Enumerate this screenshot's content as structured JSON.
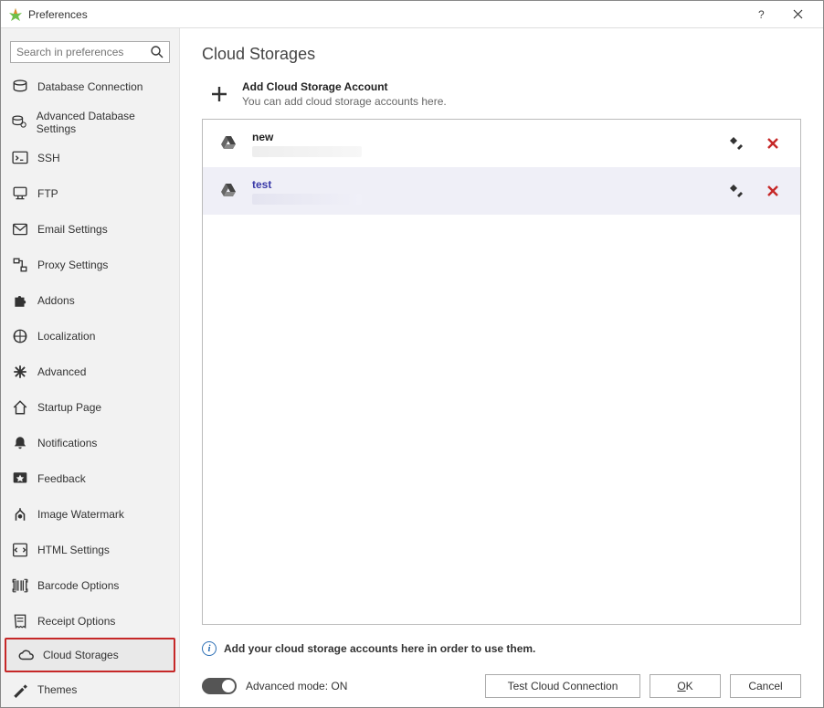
{
  "window": {
    "title": "Preferences"
  },
  "search": {
    "placeholder": "Search in preferences"
  },
  "sidebar": {
    "items": [
      {
        "icon": "database-link",
        "label": "Database Connection"
      },
      {
        "icon": "database-gear",
        "label": "Advanced Database Settings"
      },
      {
        "icon": "terminal",
        "label": "SSH"
      },
      {
        "icon": "ftp",
        "label": "FTP"
      },
      {
        "icon": "mail",
        "label": "Email Settings"
      },
      {
        "icon": "proxy",
        "label": "Proxy Settings"
      },
      {
        "icon": "puzzle",
        "label": "Addons"
      },
      {
        "icon": "globe",
        "label": "Localization"
      },
      {
        "icon": "asterisk",
        "label": "Advanced"
      },
      {
        "icon": "home",
        "label": "Startup Page"
      },
      {
        "icon": "bell",
        "label": "Notifications"
      },
      {
        "icon": "star",
        "label": "Feedback"
      },
      {
        "icon": "watermark",
        "label": "Image Watermark"
      },
      {
        "icon": "html",
        "label": "HTML Settings"
      },
      {
        "icon": "barcode",
        "label": "Barcode Options"
      },
      {
        "icon": "receipt",
        "label": "Receipt Options"
      },
      {
        "icon": "cloud",
        "label": "Cloud Storages"
      },
      {
        "icon": "themes",
        "label": "Themes"
      }
    ],
    "selected_index": 16
  },
  "main": {
    "title": "Cloud Storages",
    "add": {
      "title": "Add Cloud Storage Account",
      "subtitle": "You can add cloud storage accounts here."
    },
    "accounts": [
      {
        "name": "new",
        "provider_icon": "google-drive",
        "selected": false
      },
      {
        "name": "test",
        "provider_icon": "google-drive",
        "selected": true
      }
    ],
    "info_text": "Add your cloud storage accounts here in order to use them."
  },
  "footer": {
    "advanced_mode_label": "Advanced mode: ON",
    "advanced_mode_on": true,
    "buttons": {
      "test": "Test Cloud Connection",
      "ok": "OK",
      "cancel": "Cancel"
    }
  }
}
